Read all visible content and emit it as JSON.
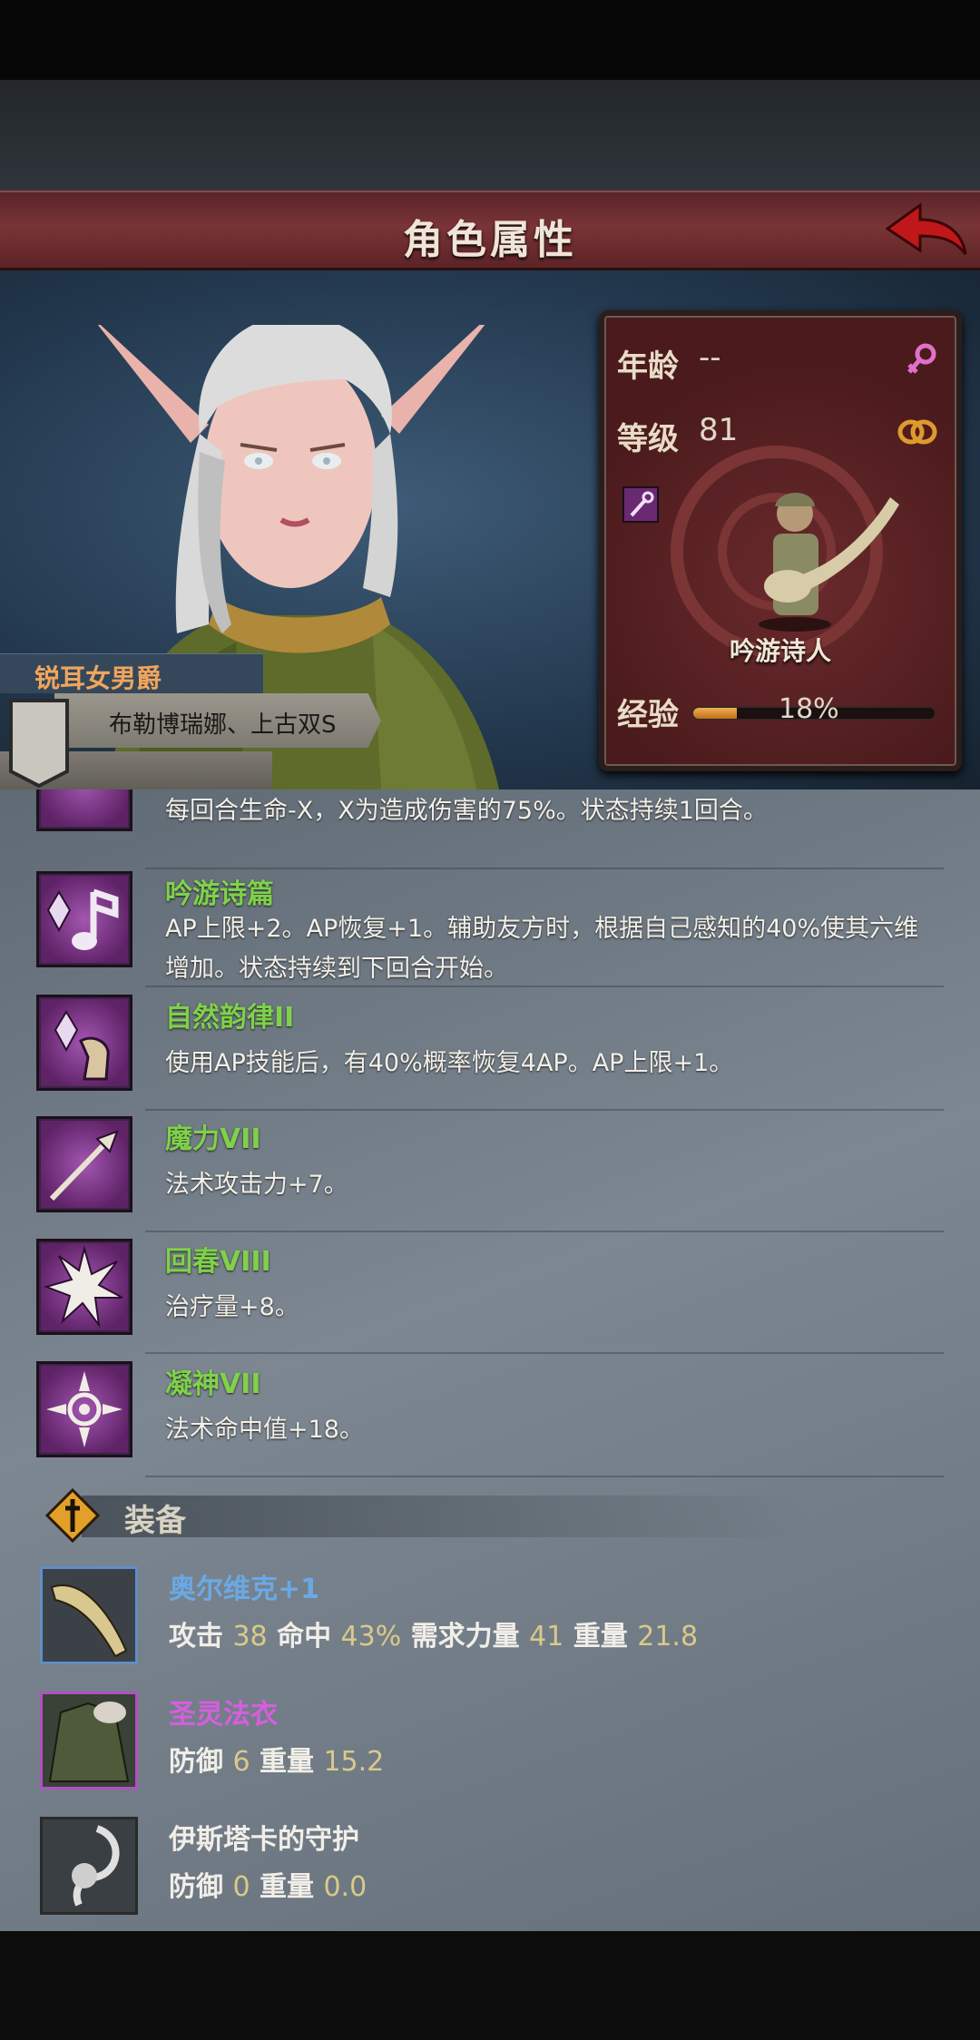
{
  "header": {
    "title": "角色属性"
  },
  "character": {
    "title_tag": "锐耳女男爵",
    "name": "布勒博瑞娜、上古双S",
    "age_label": "年龄",
    "age_value": "--",
    "level_label": "等级",
    "level_value": "81",
    "class_name": "吟游诗人",
    "exp_label": "经验",
    "exp_value": "18%",
    "exp_fraction": 0.18,
    "gender_icon": "female-icon",
    "ring_icon": "rings-icon",
    "weapon_type_icon": "staff-icon"
  },
  "skills": [
    {
      "name": "",
      "desc": "每回合生命-X，X为造成伤害的75%。状态持续1回合。",
      "icon": "partial-skill-icon"
    },
    {
      "name": "吟游诗篇",
      "desc": "AP上限+2。AP恢复+1。辅助友方时，根据自己感知的40%使其六维增加。状态持续到下回合开始。",
      "icon": "music-note-crystal-icon"
    },
    {
      "name": "自然韵律II",
      "desc": "使用AP技能后，有40%概率恢复4AP。AP上限+1。",
      "icon": "crystal-hand-icon"
    },
    {
      "name": "魔力VII",
      "desc": "法术攻击力+7。",
      "icon": "spear-staff-icon"
    },
    {
      "name": "回春VIII",
      "desc": "治疗量+8。",
      "icon": "burst-icon"
    },
    {
      "name": "凝神VII",
      "desc": "法术命中值+18。",
      "icon": "crosshair-icon"
    }
  ],
  "equipment": {
    "label": "装备",
    "items": [
      {
        "name": "奥尔维克+1",
        "name_color": "#6aa9e6",
        "frame_color": "#5f8fc4",
        "stats": [
          {
            "label": "攻击",
            "value": "38"
          },
          {
            "label": "命中",
            "value": "43%"
          },
          {
            "label": "需求力量",
            "value": "41"
          },
          {
            "label": "重量",
            "value": "21.8"
          }
        ],
        "icon": "lute-weapon-icon"
      },
      {
        "name": "圣灵法衣",
        "name_color": "#d65ee0",
        "frame_color": "#b050c4",
        "stats": [
          {
            "label": "防御",
            "value": "6"
          },
          {
            "label": "重量",
            "value": "15.2"
          }
        ],
        "icon": "robe-icon"
      },
      {
        "name": "伊斯塔卡的守护",
        "name_color": "#f1eee8",
        "frame_color": "#2a2a2a",
        "stats": [
          {
            "label": "防御",
            "value": "0"
          },
          {
            "label": "重量",
            "value": "0.0"
          }
        ],
        "icon": "charm-icon"
      }
    ]
  }
}
